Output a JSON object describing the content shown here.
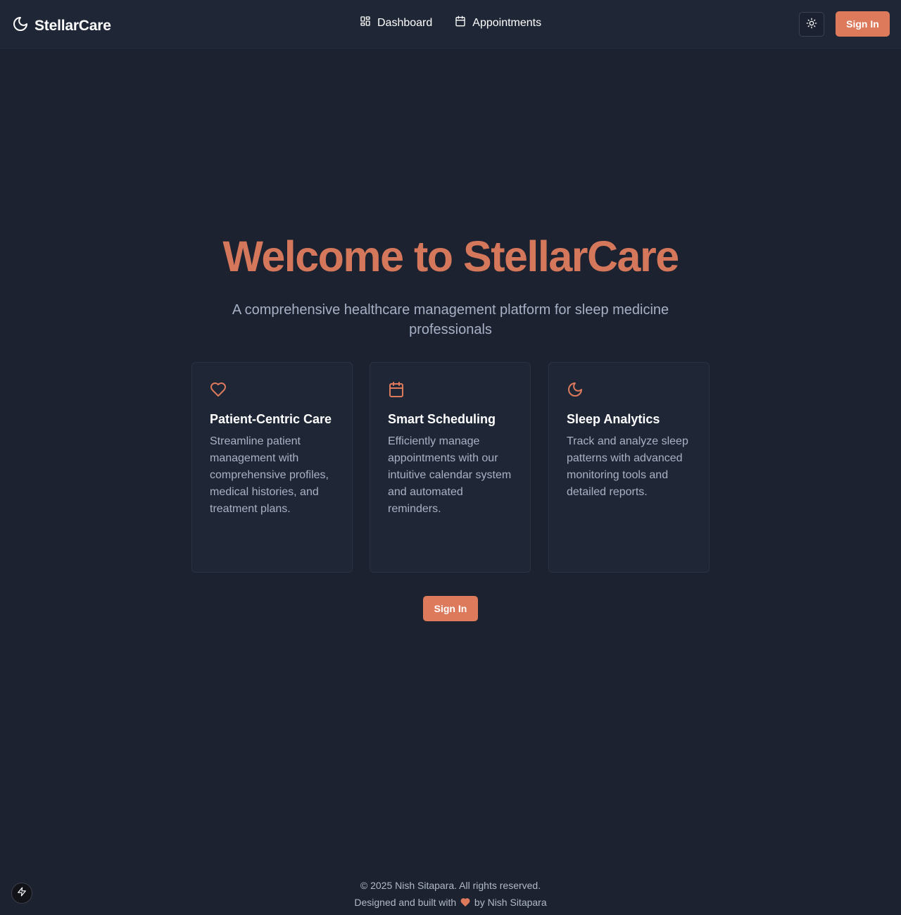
{
  "brand": {
    "name": "StellarCare",
    "icon": "moon-icon"
  },
  "nav": {
    "items": [
      {
        "label": "Dashboard",
        "icon": "dashboard-grid-icon"
      },
      {
        "label": "Appointments",
        "icon": "calendar-icon"
      }
    ]
  },
  "header": {
    "theme_toggle_icon": "sun-icon",
    "signin_label": "Sign In"
  },
  "hero": {
    "title": "Welcome to StellarCare",
    "subtitle": "A comprehensive healthcare management platform for sleep medicine professionals"
  },
  "features": [
    {
      "icon": "heart-icon",
      "title": "Patient-Centric Care",
      "text": "Streamline patient management with comprehensive profiles, medical histories, and treatment plans."
    },
    {
      "icon": "calendar-icon",
      "title": "Smart Scheduling",
      "text": "Efficiently manage appointments with our intuitive calendar system and automated reminders."
    },
    {
      "icon": "moon-icon",
      "title": "Sleep Analytics",
      "text": "Track and analyze sleep patterns with advanced monitoring tools and detailed reports."
    }
  ],
  "cta": {
    "signin_label": "Sign In"
  },
  "footer": {
    "copyright": "© 2025 Nish Sitapara. All rights reserved.",
    "built_prefix": "Designed and built with",
    "built_suffix": "by Nish Sitapara",
    "heart_icon": "heart-icon"
  },
  "badge": {
    "icon": "bolt-icon"
  },
  "colors": {
    "accent": "#dd7a5c",
    "background": "#1c2230",
    "card": "#1f2636"
  }
}
